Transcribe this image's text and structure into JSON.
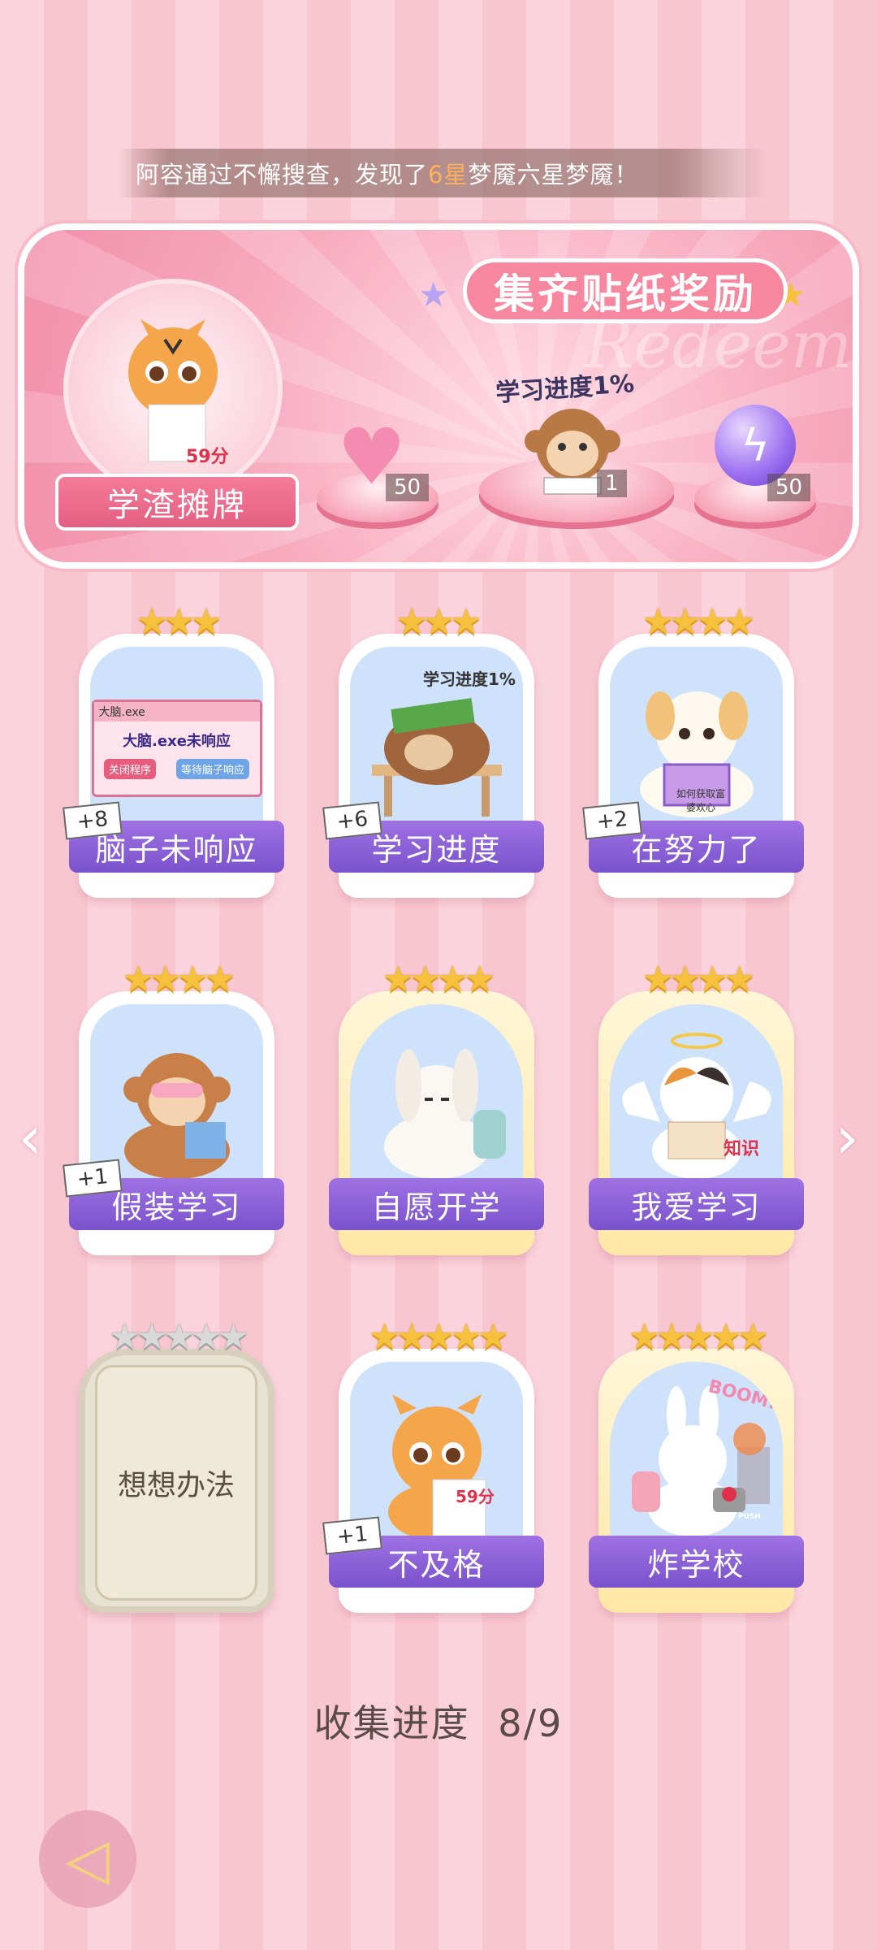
{
  "ticker": {
    "prefix": "阿容通过不懈搜查，发现了",
    "highlight": "6星",
    "suffix": "梦魇六星梦魇！"
  },
  "reward": {
    "title": "集齐贴纸奖励",
    "watermark": "Redeem",
    "badge_label": "学渣摊牌",
    "badge_score": "59分",
    "progress_label": "学习进度1%",
    "items": [
      {
        "icon": "pink-heart-gem-icon",
        "count": "50"
      },
      {
        "icon": "monkey-reading-icon",
        "count": "1"
      },
      {
        "icon": "purple-orb-icon",
        "count": "50"
      }
    ]
  },
  "cards": [
    {
      "name": "脑子未响应",
      "stars": "★★★",
      "plus": "+8",
      "art_text": "大脑.exe未响应",
      "btn1": "关闭程序",
      "btn2": "等待脑子响应",
      "window_title": "大脑.exe"
    },
    {
      "name": "学习进度",
      "stars": "★★★",
      "plus": "+6",
      "art_text": "学习进度1%"
    },
    {
      "name": "在努力了",
      "stars": "★★★★",
      "plus": "+2",
      "art_text": "如何获取富婆欢心"
    },
    {
      "name": "假装学习",
      "stars": "★★★★",
      "plus": "+1"
    },
    {
      "name": "自愿开学",
      "stars": "★★★★"
    },
    {
      "name": "我爱学习",
      "stars": "★★★★",
      "art_text": "知识"
    },
    {
      "name": "想想办法",
      "stars": "★★★★★"
    },
    {
      "name": "不及格",
      "stars": "★★★★★",
      "plus": "+1",
      "art_text": "59分"
    },
    {
      "name": "炸学校",
      "stars": "★★★★★",
      "art_text": "BOOM!!",
      "art_text2": "PUSH"
    }
  ],
  "collection": {
    "label": "收集进度",
    "value": "8/9"
  },
  "nav": {
    "left_arrow": "‹",
    "right_arrow": "›",
    "back_icon": "◁"
  }
}
